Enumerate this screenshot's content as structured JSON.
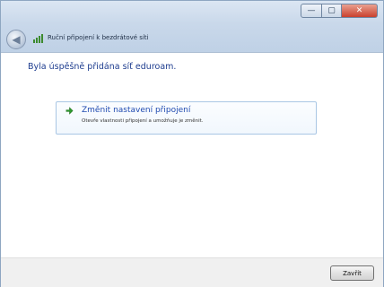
{
  "window": {
    "title": "Ruční připojení k bezdrátové síti",
    "controls": {
      "minimize": "—",
      "maximize": "▢",
      "close": "✕"
    }
  },
  "main": {
    "heading": "Byla úspěšně přidána síť eduroam.",
    "option": {
      "title": "Změnit nastavení připojení",
      "description": "Otevře vlastnosti připojení a umožňuje je změnit.",
      "icon": "green-arrow-icon"
    }
  },
  "footer": {
    "close_label": "Zavřít"
  },
  "colors": {
    "heading": "#1e3d8f",
    "option_title": "#1f4ab0",
    "option_border": "#a9c6e4",
    "titlebar": "#c9d8ea"
  }
}
